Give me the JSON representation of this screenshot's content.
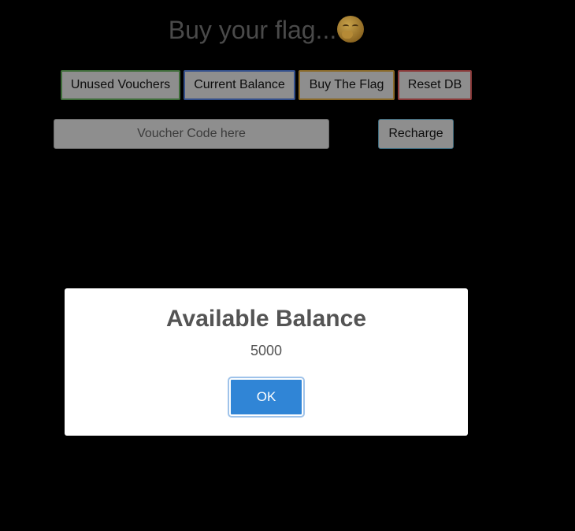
{
  "header": {
    "title": "Buy your flag...",
    "title_emoji": "face-with-hand-over-mouth-icon"
  },
  "toolbar": {
    "unused_vouchers_label": "Unused Vouchers",
    "current_balance_label": "Current Balance",
    "buy_flag_label": "Buy The Flag",
    "reset_db_label": "Reset DB"
  },
  "voucher": {
    "placeholder": "Voucher Code here",
    "value": "",
    "recharge_label": "Recharge"
  },
  "dialog": {
    "title": "Available Balance",
    "text": "5000",
    "ok_label": "OK"
  },
  "colors": {
    "page_background": "#000000",
    "dialog_background": "#ffffff",
    "ok_button": "#3085d6",
    "unused_vouchers_border": "#3f6d3a",
    "current_balance_border": "#34508c",
    "buy_flag_border": "#8a6a2a",
    "reset_db_border": "#8a3a3a"
  }
}
